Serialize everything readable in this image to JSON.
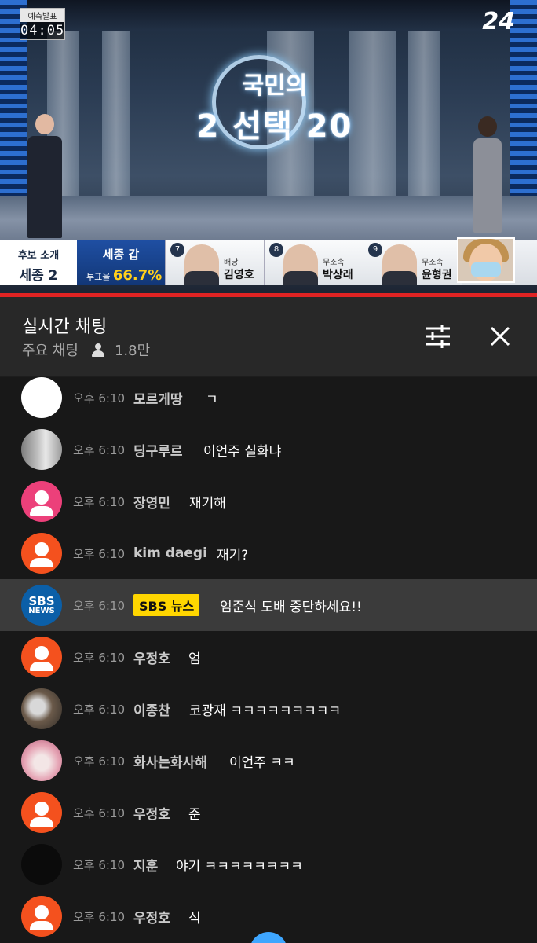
{
  "video": {
    "time_badge_label": "예측발표",
    "time_badge_time": "04:05",
    "logo_line1": "국민의",
    "logo_line2": "2 선택 20",
    "channel_logo": "24",
    "lower_third": {
      "promo_label": "후보 소개",
      "promo_district": "세종 2",
      "district": "세종 갑",
      "turnout_label": "투표율",
      "turnout_value": "66.7%",
      "candidates": [
        {
          "number": "7",
          "party": "배당",
          "name": "김영호"
        },
        {
          "number": "8",
          "party": "무소속",
          "name": "박상래"
        },
        {
          "number": "9",
          "party": "무소속",
          "name": "윤형권"
        }
      ]
    }
  },
  "chat": {
    "title": "실시간 채팅",
    "mode": "주요 채팅",
    "viewer_count": "1.8만",
    "messages": [
      {
        "time": "오후 6:10",
        "author": "모르게땅",
        "text": "ㄱ",
        "avatar": "white"
      },
      {
        "time": "오후 6:10",
        "author": "딩구루르",
        "text": "이언주 실화냐",
        "avatar": "photo-gray"
      },
      {
        "time": "오후 6:10",
        "author": "장영민",
        "text": "재기해",
        "avatar": "pink"
      },
      {
        "time": "오후 6:10",
        "author": "kim daegi",
        "text": "재기?",
        "avatar": "orange"
      },
      {
        "time": "오후 6:10",
        "author": "SBS 뉴스",
        "text": "엄준식 도배 중단하세요!!",
        "avatar": "sbs",
        "highlight": true
      },
      {
        "time": "오후 6:10",
        "author": "우정호",
        "text": "엄",
        "avatar": "orange"
      },
      {
        "time": "오후 6:10",
        "author": "이종찬",
        "text": "코광재 ㅋㅋㅋㅋㅋㅋㅋㅋㅋ",
        "avatar": "photo-cat"
      },
      {
        "time": "오후 6:10",
        "author": "화사는화사해",
        "text": "이언주 ㅋㅋ",
        "avatar": "photo-pink"
      },
      {
        "time": "오후 6:10",
        "author": "우정호",
        "text": "준",
        "avatar": "orange"
      },
      {
        "time": "오후 6:10",
        "author": "지훈",
        "text": "야기 ㅋㅋㅋㅋㅋㅋㅋㅋ",
        "avatar": "black"
      },
      {
        "time": "오후 6:10",
        "author": "우정호",
        "text": "식",
        "avatar": "orange"
      }
    ],
    "sbs_avatar_line1": "SBS",
    "sbs_avatar_line2": "NEWS"
  },
  "icons": [
    "person-icon",
    "tune-icon",
    "close-icon",
    "scroll-down-icon"
  ],
  "colors": {
    "chat_bg": "#181818",
    "header_bg": "#282828",
    "highlight_bg": "#3b3b3b",
    "owner_chip": "#ffd600",
    "avatar_orange": "#f4511e",
    "avatar_pink": "#ec407a",
    "accent_red": "#e02323",
    "scroll_button": "#3ea6ff"
  }
}
